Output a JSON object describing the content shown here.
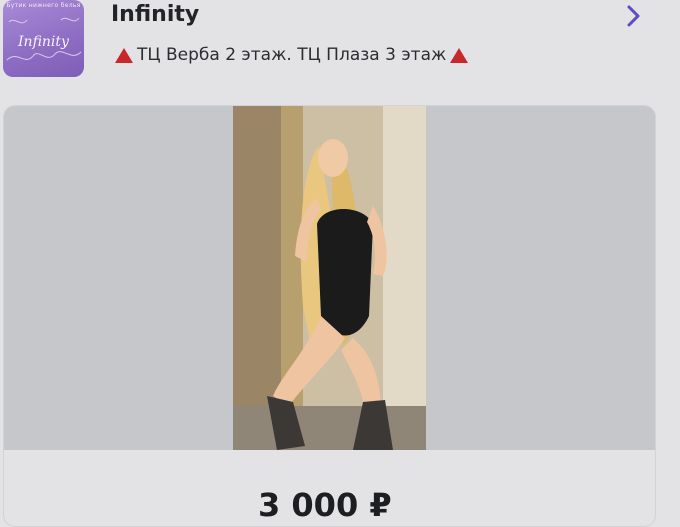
{
  "store": {
    "name": "Infinity",
    "address_text": "ТЦ Верба 2 этаж. ТЦ Плаза 3 этаж",
    "logo": {
      "tagline": "Бутик нижнего белья",
      "script": "Infinity",
      "bg_color": "#8f6fc4"
    },
    "address_icon": "red-triangle-icon",
    "open_icon": "chevron-right-icon"
  },
  "product": {
    "price": "3 000 ₽",
    "photo_description_icon": "product-photo"
  },
  "colors": {
    "accent": "#5b4bc4",
    "marker_red": "#c8282a"
  }
}
